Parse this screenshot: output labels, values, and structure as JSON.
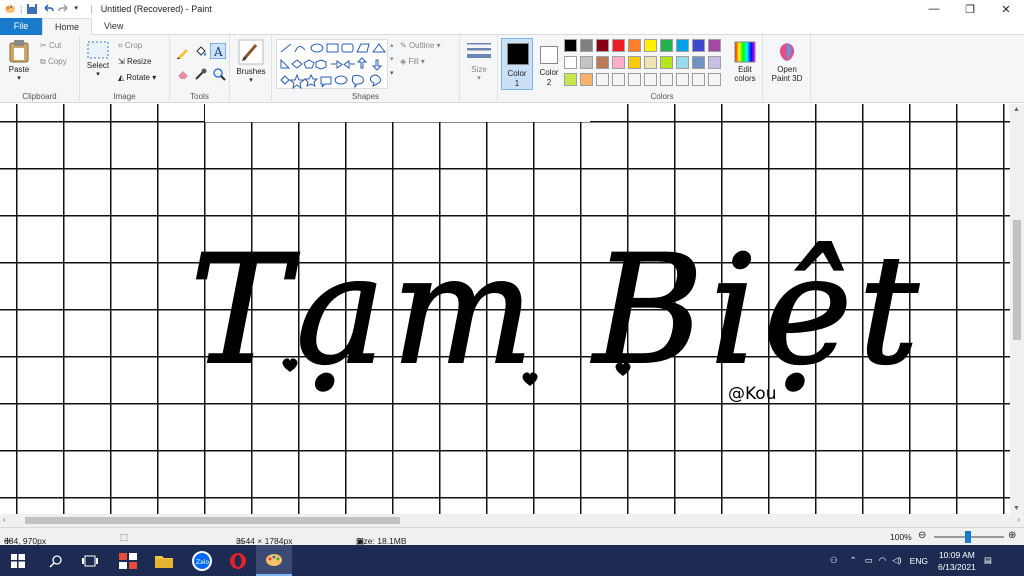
{
  "window": {
    "title": "Untitled (Recovered) - Paint"
  },
  "tabs": [
    "File",
    "Home",
    "View"
  ],
  "ribbon": {
    "clipboard": {
      "paste": "Paste",
      "cut": "Cut",
      "copy": "Copy",
      "label": "Clipboard"
    },
    "image": {
      "select": "Select",
      "crop": "Crop",
      "resize": "Resize",
      "rotate": "Rotate",
      "label": "Image"
    },
    "tools": {
      "label": "Tools"
    },
    "brushes": {
      "label": "Brushes"
    },
    "shapes": {
      "outline": "Outline",
      "fill": "Fill",
      "label": "Shapes"
    },
    "size": {
      "label": "Size"
    },
    "color1": {
      "line1": "Color",
      "line2": "1"
    },
    "color2": {
      "line1": "Color",
      "line2": "2"
    },
    "colors": {
      "label": "Colors",
      "edit_line1": "Edit",
      "edit_line2": "colors"
    },
    "paint3d": {
      "line1": "Open",
      "line2": "Paint 3D"
    }
  },
  "palette": {
    "row1": [
      "#000000",
      "#7f7f7f",
      "#880015",
      "#ed1c24",
      "#ff7f27",
      "#fff200",
      "#22b14c",
      "#00a2e8",
      "#3f48cc",
      "#a349a4"
    ],
    "row2": [
      "#ffffff",
      "#c3c3c3",
      "#b97a57",
      "#ffaec9",
      "#ffc90e",
      "#efe4b0",
      "#b5e61d",
      "#99d9ea",
      "#7092be",
      "#c8bfe7"
    ],
    "row3": [
      "#c8e64c",
      "#f8b26a",
      "#f5f5f5",
      "#f5f5f5",
      "#f5f5f5",
      "#f5f5f5",
      "#f5f5f5",
      "#f5f5f5",
      "#f5f5f5",
      "#f5f5f5"
    ],
    "color1_value": "#000000",
    "color2_value": "#ffffff"
  },
  "canvas": {
    "artwork_text": "Tạm Biệt",
    "signature": "@Kou"
  },
  "status": {
    "position": "684, 970px",
    "dimensions": "3544 × 1784px",
    "size": "Size: 18.1MB",
    "zoom": "100%"
  },
  "taskbar": {
    "lang": "ENG",
    "time": "10:09 AM",
    "date": "6/13/2021"
  }
}
